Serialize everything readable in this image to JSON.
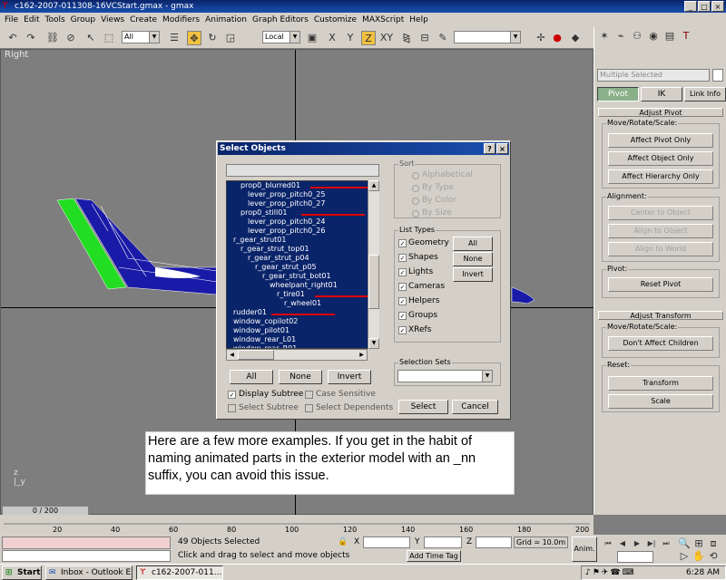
{
  "window": {
    "title": "c162-2007-011308-16VCStart.gmax - gmax",
    "minimize": "_",
    "maximize": "□",
    "close": "×"
  },
  "menu": [
    "File",
    "Edit",
    "Tools",
    "Group",
    "Views",
    "Create",
    "Modifiers",
    "Animation",
    "Graph Editors",
    "Customize",
    "MAXScript",
    "Help"
  ],
  "toolbar": {
    "selection_filter": "All",
    "coord_system": "Local"
  },
  "viewport": {
    "label": "Right"
  },
  "command_panel": {
    "selection_name": "Multiple Selected",
    "tabs": [
      "Pivot",
      "IK",
      "Link Info"
    ],
    "adjust_pivot": {
      "header": "Adjust Pivot",
      "move_group": "Move/Rotate/Scale:",
      "buttons": [
        "Affect Pivot Only",
        "Affect Object Only",
        "Affect Hierarchy Only"
      ],
      "alignment_group": "Alignment:",
      "align_buttons": [
        "Center to Object",
        "Align to Object",
        "Align to World"
      ],
      "pivot_group": "Pivot:",
      "reset_pivot": "Reset Pivot"
    },
    "adjust_transform": {
      "header": "Adjust Transform",
      "move_group": "Move/Rotate/Scale:",
      "dont_affect": "Don't Affect Children",
      "reset_group": "Reset:",
      "transform": "Transform",
      "scale": "Scale"
    }
  },
  "dialog": {
    "title": "Select Objects",
    "help": "?",
    "close": "×",
    "search_value": "",
    "objects": [
      {
        "name": "prop0_blurred01",
        "indent": 1,
        "marked": true
      },
      {
        "name": "lever_prop_pitch0_25",
        "indent": 2,
        "marked": false
      },
      {
        "name": "lever_prop_pitch0_27",
        "indent": 2,
        "marked": false
      },
      {
        "name": "prop0_still01",
        "indent": 1,
        "marked": true
      },
      {
        "name": "lever_prop_pitch0_24",
        "indent": 2,
        "marked": false
      },
      {
        "name": "lever_prop_pitch0_26",
        "indent": 2,
        "marked": false
      },
      {
        "name": "r_gear_strut01",
        "indent": 0,
        "marked": false
      },
      {
        "name": "r_gear_strut_top01",
        "indent": 1,
        "marked": false
      },
      {
        "name": "r_gear_strut_p04",
        "indent": 2,
        "marked": false
      },
      {
        "name": "r_gear_strut_p05",
        "indent": 3,
        "marked": false
      },
      {
        "name": "r_gear_strut_bot01",
        "indent": 4,
        "marked": false
      },
      {
        "name": "wheelpant_right01",
        "indent": 5,
        "marked": false
      },
      {
        "name": "r_tire01",
        "indent": 6,
        "marked": true
      },
      {
        "name": "r_wheel01",
        "indent": 7,
        "marked": false
      },
      {
        "name": "rudder01",
        "indent": 0,
        "marked": true
      },
      {
        "name": "window_copilot02",
        "indent": 0,
        "marked": false
      },
      {
        "name": "window_pilot01",
        "indent": 0,
        "marked": false
      },
      {
        "name": "window_rear_L01",
        "indent": 0,
        "marked": false
      },
      {
        "name": "window_rear_R01",
        "indent": 0,
        "marked": false
      }
    ],
    "bottom_buttons": [
      "All",
      "None",
      "Invert"
    ],
    "display_subtree": "Display Subtree",
    "select_subtree": "Select Subtree",
    "case_sensitive": "Case Sensitive",
    "select_dependents": "Select Dependents",
    "sort": {
      "label": "Sort",
      "options": [
        "Alphabetical",
        "By Type",
        "By Color",
        "By Size"
      ]
    },
    "list_types": {
      "label": "List Types",
      "items": [
        "Geometry",
        "Shapes",
        "Lights",
        "Cameras",
        "Helpers",
        "Groups",
        "XRefs"
      ],
      "buttons": [
        "All",
        "None",
        "Invert"
      ]
    },
    "selection_sets": {
      "label": "Selection Sets",
      "value": ""
    },
    "select_button": "Select",
    "cancel_button": "Cancel"
  },
  "note": "Here are a few more examples.  If you get in the habit of naming animated parts in the exterior model with an _nn suffix, you can avoid this issue.",
  "timeline": {
    "slider": "0 / 200",
    "ticks": [
      "20",
      "40",
      "60",
      "80",
      "100",
      "120",
      "140",
      "160",
      "180",
      "200"
    ]
  },
  "status": {
    "selection": "49 Objects Selected",
    "prompt": "Click and drag to select and move objects",
    "x_label": "X",
    "y_label": "Y",
    "z_label": "Z",
    "grid": "Grid = 10.0m",
    "add_time_tag": "Add Time Tag",
    "anim": "Anim."
  },
  "taskbar": {
    "start": "Start",
    "tasks": [
      "Inbox - Outlook E...",
      "c162-2007-011..."
    ],
    "clock": "6:28 AM"
  },
  "colors": {
    "title_blue": "#0a246a",
    "list_bg": "#0a246a",
    "viewport": "#7e7e7e",
    "panel": "#d4d0c8",
    "red_mark": "#e00000",
    "plane_green": "#22dd22"
  }
}
